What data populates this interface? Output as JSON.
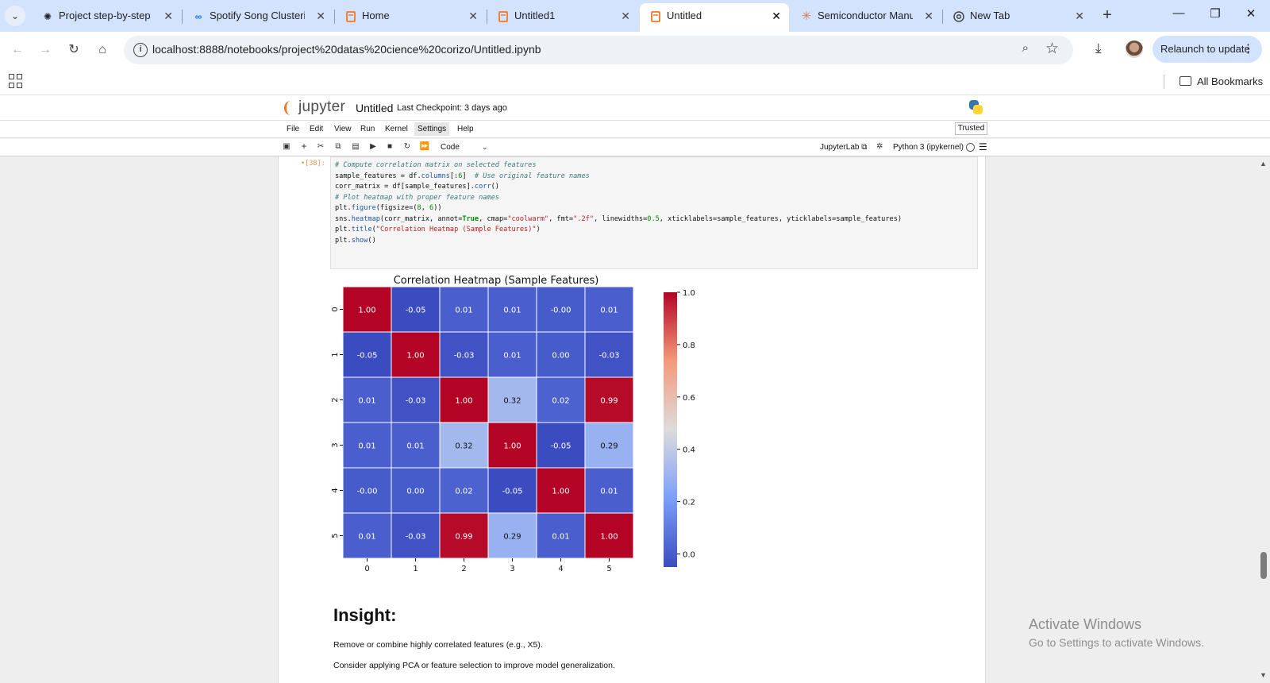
{
  "browser": {
    "tabs": [
      {
        "title": "Project step-by-step g",
        "icon": "chatgpt-icon",
        "active": false
      },
      {
        "title": "Spotify Song Clustering",
        "icon": "colab-icon",
        "active": false
      },
      {
        "title": "Home",
        "icon": "jupyter-icon",
        "active": false
      },
      {
        "title": "Untitled1",
        "icon": "jupyter-icon",
        "active": false
      },
      {
        "title": "Untitled",
        "icon": "jupyter-icon",
        "active": true
      },
      {
        "title": "Semiconductor Manuf",
        "icon": "claude-icon",
        "active": false
      },
      {
        "title": "New Tab",
        "icon": "chrome-icon",
        "active": false
      }
    ],
    "url": "localhost:8888/notebooks/project%20datas%20cience%20corizo/Untitled.ipynb",
    "relaunch_label": "Relaunch to update",
    "all_bookmarks_label": "All Bookmarks"
  },
  "jupyter": {
    "logo_text": "jupyter",
    "notebook_title": "Untitled",
    "checkpoint": "Last Checkpoint: 3 days ago",
    "menu": [
      "File",
      "Edit",
      "View",
      "Run",
      "Kernel",
      "Settings",
      "Help"
    ],
    "trusted_label": "Trusted",
    "cell_type": "Code",
    "jupyterlab_link": "JupyterLab",
    "kernel_name": "Python 3 (ipykernel)"
  },
  "cell": {
    "prompt": "[38]:",
    "code_lines": [
      "# Compute correlation matrix on selected features",
      "sample_features = df.columns[:6]  # Use original feature names",
      "corr_matrix = df[sample_features].corr()",
      "",
      "# Plot heatmap with proper feature names",
      "plt.figure(figsize=(8, 6))",
      "sns.heatmap(corr_matrix, annot=True, cmap=\"coolwarm\", fmt=\".2f\", linewidths=0.5, xticklabels=sample_features, yticklabels=sample_features)",
      "plt.title(\"Correlation Heatmap (Sample Features)\")",
      "plt.show()"
    ]
  },
  "chart_data": {
    "type": "heatmap",
    "title": "Correlation Heatmap (Sample Features)",
    "x_labels": [
      "0",
      "1",
      "2",
      "3",
      "4",
      "5"
    ],
    "y_labels": [
      "0",
      "1",
      "2",
      "3",
      "4",
      "5"
    ],
    "values": [
      [
        1.0,
        -0.05,
        0.01,
        0.01,
        -0.0,
        0.01
      ],
      [
        -0.05,
        1.0,
        -0.03,
        0.01,
        0.0,
        -0.03
      ],
      [
        0.01,
        -0.03,
        1.0,
        0.32,
        0.02,
        0.99
      ],
      [
        0.01,
        0.01,
        0.32,
        1.0,
        -0.05,
        0.29
      ],
      [
        -0.0,
        0.0,
        0.02,
        -0.05,
        1.0,
        0.01
      ],
      [
        0.01,
        -0.03,
        0.99,
        0.29,
        0.01,
        1.0
      ]
    ],
    "value_labels": [
      [
        "1.00",
        "-0.05",
        "0.01",
        "0.01",
        "-0.00",
        "0.01"
      ],
      [
        "-0.05",
        "1.00",
        "-0.03",
        "0.01",
        "0.00",
        "-0.03"
      ],
      [
        "0.01",
        "-0.03",
        "1.00",
        "0.32",
        "0.02",
        "0.99"
      ],
      [
        "0.01",
        "0.01",
        "0.32",
        "1.00",
        "-0.05",
        "0.29"
      ],
      [
        "-0.00",
        "0.00",
        "0.02",
        "-0.05",
        "1.00",
        "0.01"
      ],
      [
        "0.01",
        "-0.03",
        "0.99",
        "0.29",
        "0.01",
        "1.00"
      ]
    ],
    "colormap": "coolwarm",
    "colorbar_range": [
      -0.05,
      1.0
    ],
    "colorbar_ticks": [
      0.0,
      0.2,
      0.4,
      0.6,
      0.8,
      1.0
    ],
    "colorbar_tick_labels": [
      "0.0",
      "0.2",
      "0.4",
      "0.6",
      "0.8",
      "1.0"
    ],
    "colors": {
      "low": "#3b4cc0",
      "mid": "#dddddd",
      "high": "#b40426"
    }
  },
  "markdown": {
    "heading": "Insight:",
    "paragraphs": [
      "Remove or combine highly correlated features (e.g., X5).",
      "Consider applying PCA or feature selection to improve model generalization."
    ]
  },
  "watermark": {
    "line1": "Activate Windows",
    "line2": "Go to Settings to activate Windows."
  }
}
